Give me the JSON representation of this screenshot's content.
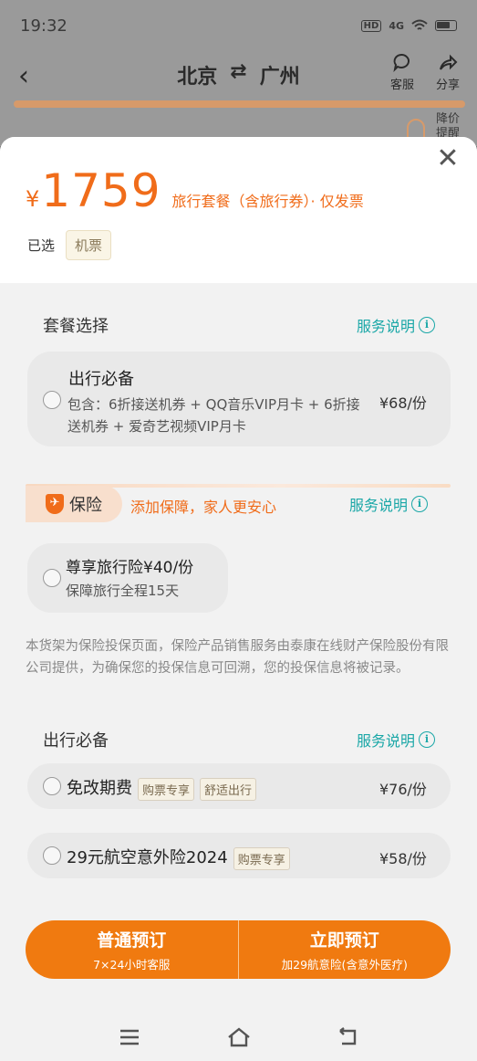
{
  "status": {
    "time": "19:32",
    "hd": "HD",
    "network": "4G"
  },
  "nav": {
    "origin": "北京",
    "destination": "广州",
    "route_arrow": "⇄",
    "service": "客服",
    "share": "分享",
    "price_drop": "降价",
    "price_drop_2": "提醒"
  },
  "sheet": {
    "currency": "¥",
    "price": "1759",
    "price_desc": "旅行套餐（含旅行券）· 仅发票",
    "selected_label": "已选",
    "selected_chip": "机票"
  },
  "package": {
    "title": "套餐选择",
    "service_link": "服务说明",
    "card": {
      "title": "出行必备",
      "desc": "包含：6折接送机券 + QQ音乐VIP月卡 + 6折接送机券 + 爱奇艺视频VIP月卡",
      "price": "¥68/份"
    }
  },
  "insurance": {
    "badge": "保险",
    "slogan": "添加保障，家人更安心",
    "service_link": "服务说明",
    "card": {
      "title": "尊享旅行险¥40/份",
      "desc": "保障旅行全程15天"
    },
    "disclaimer": "本货架为保险投保页面，保险产品销售服务由泰康在线财产保险股份有限公司提供，为确保您的投保信息可回溯，您的投保信息将被记录。"
  },
  "essentials": {
    "title": "出行必备",
    "service_link": "服务说明",
    "items": [
      {
        "title": "免改期费",
        "tags": [
          "购票专享",
          "舒适出行"
        ],
        "price": "¥76/份"
      },
      {
        "title": "29元航空意外险2024",
        "tags": [
          "购票专享"
        ],
        "price": "¥58/份"
      }
    ]
  },
  "actions": {
    "normal": {
      "label": "普通预订",
      "sub": "7×24小时客服"
    },
    "instant": {
      "label": "立即预订",
      "sub": "加29航意险(含意外医疗)"
    }
  },
  "colors": {
    "accent": "#f06c1a",
    "link": "#1aa7a7",
    "button": "#f07a10"
  }
}
